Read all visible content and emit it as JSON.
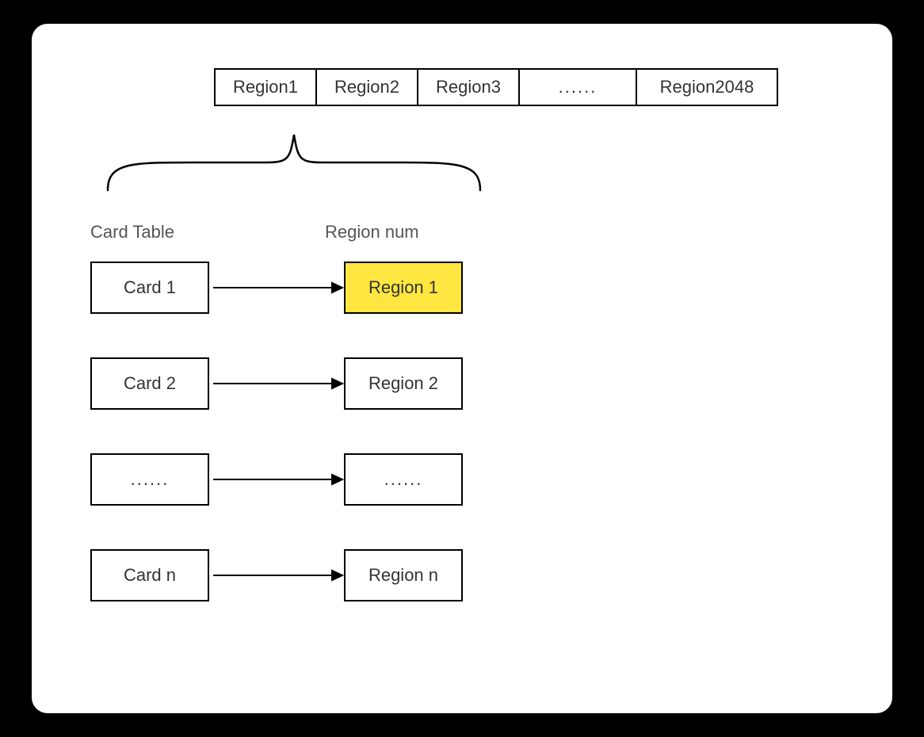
{
  "region_row": {
    "cells": [
      "Region1",
      "Region2",
      "Region3",
      "......",
      "Region2048"
    ]
  },
  "headers": {
    "card_table": "Card Table",
    "region_num": "Region num"
  },
  "mappings": [
    {
      "card": "Card 1",
      "region": "Region 1",
      "highlight": true
    },
    {
      "card": "Card 2",
      "region": "Region 2",
      "highlight": false
    },
    {
      "card": "......",
      "region": "......",
      "highlight": false
    },
    {
      "card": "Card n",
      "region": "Region n",
      "highlight": false
    }
  ]
}
